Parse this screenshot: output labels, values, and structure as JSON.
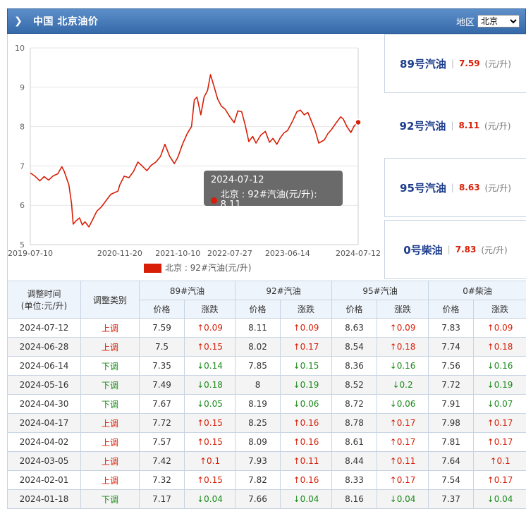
{
  "header": {
    "title": "中国 北京油价",
    "region_label": "地区",
    "region_options": [
      "北京"
    ],
    "region_selected": "北京",
    "colors": {
      "bar": "#3f73b3"
    }
  },
  "chart_data": {
    "type": "line",
    "x_tick_labels": [
      "2019-07-10",
      "2020-11-20",
      "2021-10-10",
      "2022-07-27",
      "2023-06-14",
      "2024-07-12"
    ],
    "y_tick_labels": [
      "5",
      "6",
      "7",
      "8",
      "9",
      "10"
    ],
    "ylim": [
      5,
      10
    ],
    "xlim": [
      "2019-07-10",
      "2024-07-12"
    ],
    "grid": "horizontal",
    "series": [
      {
        "name": "北京 : 92#汽油(元/升)",
        "color": "#d81e06",
        "points": [
          [
            "2019-07-10",
            6.82
          ],
          [
            "2019-08-05",
            6.74
          ],
          [
            "2019-09-01",
            6.62
          ],
          [
            "2019-09-25",
            6.73
          ],
          [
            "2019-10-20",
            6.64
          ],
          [
            "2019-11-15",
            6.75
          ],
          [
            "2019-12-10",
            6.8
          ],
          [
            "2020-01-02",
            6.98
          ],
          [
            "2020-01-15",
            6.86
          ],
          [
            "2020-02-10",
            6.52
          ],
          [
            "2020-02-25",
            6.04
          ],
          [
            "2020-03-05",
            5.52
          ],
          [
            "2020-03-20",
            5.6
          ],
          [
            "2020-04-10",
            5.68
          ],
          [
            "2020-04-25",
            5.5
          ],
          [
            "2020-05-10",
            5.58
          ],
          [
            "2020-06-01",
            5.45
          ],
          [
            "2020-06-20",
            5.62
          ],
          [
            "2020-07-15",
            5.85
          ],
          [
            "2020-08-10",
            5.96
          ],
          [
            "2020-09-05",
            6.12
          ],
          [
            "2020-10-01",
            6.28
          ],
          [
            "2020-11-10",
            6.36
          ],
          [
            "2020-11-20",
            6.52
          ],
          [
            "2020-12-15",
            6.74
          ],
          [
            "2021-01-10",
            6.7
          ],
          [
            "2021-02-05",
            6.86
          ],
          [
            "2021-03-01",
            7.1
          ],
          [
            "2021-03-25",
            7.0
          ],
          [
            "2021-04-20",
            6.88
          ],
          [
            "2021-05-15",
            7.02
          ],
          [
            "2021-06-10",
            7.1
          ],
          [
            "2021-07-05",
            7.24
          ],
          [
            "2021-07-30",
            7.55
          ],
          [
            "2021-08-25",
            7.25
          ],
          [
            "2021-09-20",
            7.06
          ],
          [
            "2021-10-10",
            7.22
          ],
          [
            "2021-11-05",
            7.55
          ],
          [
            "2021-12-01",
            7.82
          ],
          [
            "2021-12-25",
            8.0
          ],
          [
            "2022-01-10",
            8.68
          ],
          [
            "2022-01-25",
            8.75
          ],
          [
            "2022-02-15",
            8.3
          ],
          [
            "2022-03-05",
            8.75
          ],
          [
            "2022-03-25",
            8.92
          ],
          [
            "2022-04-10",
            9.32
          ],
          [
            "2022-04-30",
            9.02
          ],
          [
            "2022-05-20",
            8.7
          ],
          [
            "2022-06-10",
            8.52
          ],
          [
            "2022-07-01",
            8.44
          ],
          [
            "2022-07-27",
            8.25
          ],
          [
            "2022-08-20",
            8.1
          ],
          [
            "2022-09-10",
            8.4
          ],
          [
            "2022-10-01",
            8.38
          ],
          [
            "2022-10-20",
            8.05
          ],
          [
            "2022-11-10",
            7.62
          ],
          [
            "2022-12-01",
            7.75
          ],
          [
            "2022-12-20",
            7.58
          ],
          [
            "2023-01-15",
            7.78
          ],
          [
            "2023-02-10",
            7.88
          ],
          [
            "2023-03-05",
            7.6
          ],
          [
            "2023-03-25",
            7.7
          ],
          [
            "2023-04-15",
            7.55
          ],
          [
            "2023-05-05",
            7.72
          ],
          [
            "2023-05-25",
            7.84
          ],
          [
            "2023-06-14",
            7.9
          ],
          [
            "2023-07-10",
            8.12
          ],
          [
            "2023-08-05",
            8.38
          ],
          [
            "2023-08-25",
            8.42
          ],
          [
            "2023-09-15",
            8.3
          ],
          [
            "2023-10-05",
            8.36
          ],
          [
            "2023-10-25",
            8.14
          ],
          [
            "2023-11-15",
            7.9
          ],
          [
            "2023-12-05",
            7.58
          ],
          [
            "2024-01-05",
            7.66
          ],
          [
            "2024-01-25",
            7.82
          ],
          [
            "2024-02-15",
            7.93
          ],
          [
            "2024-03-10",
            8.09
          ],
          [
            "2024-04-05",
            8.25
          ],
          [
            "2024-04-20",
            8.19
          ],
          [
            "2024-05-10",
            8.0
          ],
          [
            "2024-06-01",
            7.85
          ],
          [
            "2024-06-20",
            8.02
          ],
          [
            "2024-07-12",
            8.11
          ]
        ]
      }
    ],
    "legend": {
      "label": "北京 : 92#汽油(元/升)",
      "placement": "bottom-center"
    },
    "tooltip": {
      "date": "2024-07-12",
      "label": "北京 : 92#汽油(元/升): 8.11"
    }
  },
  "prices": [
    {
      "name": "89号汽油",
      "value": "7.59",
      "unit": "(元/升)"
    },
    {
      "name": "92号汽油",
      "value": "8.11",
      "unit": "(元/升)"
    },
    {
      "name": "95号汽油",
      "value": "8.63",
      "unit": "(元/升)"
    },
    {
      "name": "0号柴油",
      "value": "7.83",
      "unit": "(元/升)"
    }
  ],
  "table": {
    "head_time": "调整时间",
    "head_time_unit": "(单位:元/升)",
    "head_type": "调整类别",
    "groups": [
      "89#汽油",
      "92#汽油",
      "95#汽油",
      "0#柴油"
    ],
    "sub_price": "价格",
    "sub_change": "涨跌",
    "rows": [
      {
        "date": "2024-07-12",
        "type": "上调",
        "dir": "up",
        "cells": [
          "7.59",
          "↑0.09",
          "8.11",
          "↑0.09",
          "8.63",
          "↑0.09",
          "7.83",
          "↑0.09"
        ]
      },
      {
        "date": "2024-06-28",
        "type": "上调",
        "dir": "up",
        "cells": [
          "7.5",
          "↑0.15",
          "8.02",
          "↑0.17",
          "8.54",
          "↑0.18",
          "7.74",
          "↑0.18"
        ]
      },
      {
        "date": "2024-06-14",
        "type": "下调",
        "dir": "down",
        "cells": [
          "7.35",
          "↓0.14",
          "7.85",
          "↓0.15",
          "8.36",
          "↓0.16",
          "7.56",
          "↓0.16"
        ]
      },
      {
        "date": "2024-05-16",
        "type": "下调",
        "dir": "down",
        "cells": [
          "7.49",
          "↓0.18",
          "8",
          "↓0.19",
          "8.52",
          "↓0.2",
          "7.72",
          "↓0.19"
        ]
      },
      {
        "date": "2024-04-30",
        "type": "下调",
        "dir": "down",
        "cells": [
          "7.67",
          "↓0.05",
          "8.19",
          "↓0.06",
          "8.72",
          "↓0.06",
          "7.91",
          "↓0.07"
        ]
      },
      {
        "date": "2024-04-17",
        "type": "上调",
        "dir": "up",
        "cells": [
          "7.72",
          "↑0.15",
          "8.25",
          "↑0.16",
          "8.78",
          "↑0.17",
          "7.98",
          "↑0.17"
        ]
      },
      {
        "date": "2024-04-02",
        "type": "上调",
        "dir": "up",
        "cells": [
          "7.57",
          "↑0.15",
          "8.09",
          "↑0.16",
          "8.61",
          "↑0.17",
          "7.81",
          "↑0.17"
        ]
      },
      {
        "date": "2024-03-05",
        "type": "上调",
        "dir": "up",
        "cells": [
          "7.42",
          "↑0.1",
          "7.93",
          "↑0.11",
          "8.44",
          "↑0.11",
          "7.64",
          "↑0.1"
        ]
      },
      {
        "date": "2024-02-01",
        "type": "上调",
        "dir": "up",
        "cells": [
          "7.32",
          "↑0.15",
          "7.82",
          "↑0.16",
          "8.33",
          "↑0.17",
          "7.54",
          "↑0.17"
        ]
      },
      {
        "date": "2024-01-18",
        "type": "下调",
        "dir": "down",
        "cells": [
          "7.17",
          "↓0.04",
          "7.66",
          "↓0.04",
          "8.16",
          "↓0.04",
          "7.37",
          "↓0.04"
        ]
      }
    ]
  }
}
